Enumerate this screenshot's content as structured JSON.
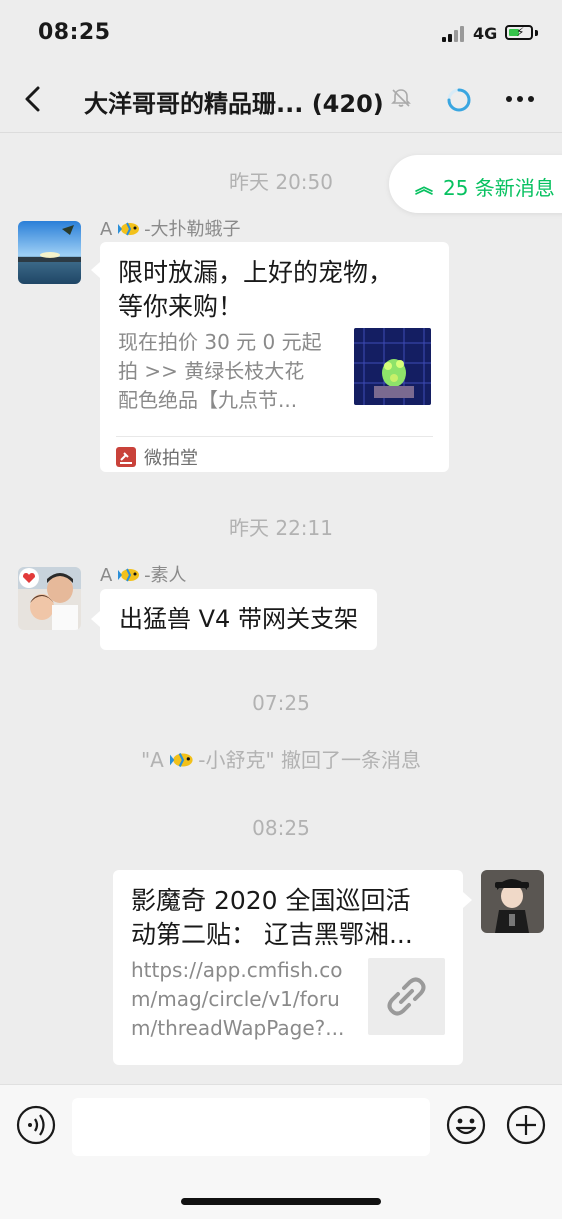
{
  "status_bar": {
    "time": "08:25",
    "network": "4G"
  },
  "nav": {
    "title": "大洋哥哥的精品珊... (420)"
  },
  "new_messages": {
    "label": "25 条新消息"
  },
  "messages": [
    {
      "type": "time",
      "text": "昨天 20:50"
    },
    {
      "type": "card",
      "sender_prefix": "A",
      "sender_suffix": "-大扑勒蛾子",
      "title_line1": "限时放漏，上好的宠物，",
      "title_line2": "等你来购！",
      "desc_line1": "现在拍价 30 元 0 元起",
      "desc_line2": "拍 >> 黄绿长枝大花",
      "desc_line3": "配色绝品【九点节...",
      "source": "微拍堂"
    },
    {
      "type": "time",
      "text": "昨天 22:11"
    },
    {
      "type": "text",
      "sender_prefix": "A",
      "sender_suffix": "-素人",
      "text": "出猛兽 V4 带网关支架"
    },
    {
      "type": "time",
      "text": "07:25"
    },
    {
      "type": "recall",
      "prefix": "\"A",
      "suffix": "-小舒克\" 撤回了一条消息"
    },
    {
      "type": "time",
      "text": "08:25"
    },
    {
      "type": "link",
      "title_line1": "影魔奇 2020 全国巡回活",
      "title_line2": "动第二贴：  辽吉黑鄂湘...",
      "url_line1": "https://app.cmfish.co",
      "url_line2": "m/mag/circle/v1/foru",
      "url_line3": "m/threadWapPage?..."
    }
  ],
  "colors": {
    "accent_green": "#07c160",
    "background": "#ededed",
    "bubble": "#ffffff"
  }
}
